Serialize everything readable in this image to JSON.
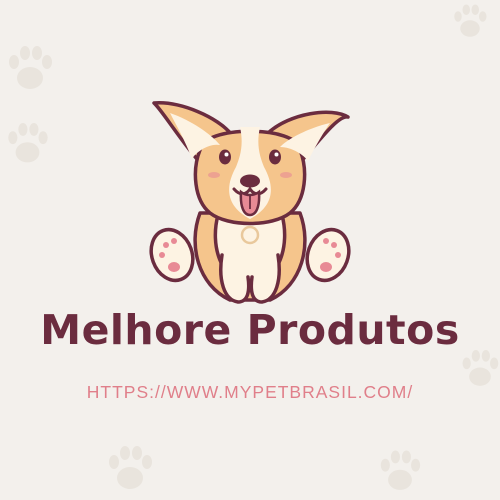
{
  "brand": {
    "title": "Melhore Produtos",
    "url": "HTTPS://WWW.MYPETBRASIL.COM/"
  },
  "colors": {
    "background": "#f3f0ec",
    "title": "#6b2c3f",
    "url": "#e07f8a",
    "outline": "#6b2c3f",
    "fur": "#f5c58c",
    "cream": "#fdf3e3",
    "pink": "#e88a95",
    "paw_decor": "#e9e4dd"
  },
  "icons": {
    "mascot": "corgi-puppy-icon",
    "decor": "paw-print-icon"
  }
}
